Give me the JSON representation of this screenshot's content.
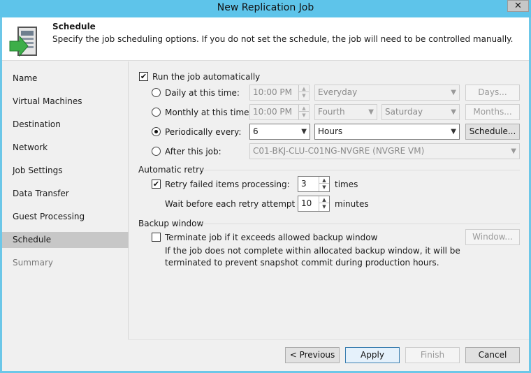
{
  "window": {
    "title": "New Replication Job",
    "close_glyph": "✕"
  },
  "header": {
    "title": "Schedule",
    "description": "Specify the job scheduling options. If you do not set the schedule, the job will need to be controlled manually.",
    "icon": "schedule-wizard-icon"
  },
  "sidebar": {
    "items": [
      {
        "label": "Name",
        "state": "normal"
      },
      {
        "label": "Virtual Machines",
        "state": "normal"
      },
      {
        "label": "Destination",
        "state": "normal"
      },
      {
        "label": "Network",
        "state": "normal"
      },
      {
        "label": "Job Settings",
        "state": "normal"
      },
      {
        "label": "Data Transfer",
        "state": "normal"
      },
      {
        "label": "Guest Processing",
        "state": "normal"
      },
      {
        "label": "Schedule",
        "state": "active"
      },
      {
        "label": "Summary",
        "state": "disabled"
      }
    ]
  },
  "schedule": {
    "run_auto": {
      "label": "Run the job automatically",
      "checked": true
    },
    "daily": {
      "label": "Daily at this time:",
      "time": "10:00 PM",
      "days": "Everyday",
      "button": "Days...",
      "selected": false
    },
    "monthly": {
      "label": "Monthly at this time:",
      "time": "10:00 PM",
      "week": "Fourth",
      "weekday": "Saturday",
      "button": "Months...",
      "selected": false
    },
    "periodic": {
      "label": "Periodically every:",
      "value": "6",
      "unit": "Hours",
      "button": "Schedule...",
      "selected": true
    },
    "after": {
      "label": "After this job:",
      "job": "C01-BKJ-CLU-C01NG-NVGRE (NVGRE VM)",
      "selected": false
    }
  },
  "retry": {
    "group_title": "Automatic retry",
    "retry_failed": {
      "label": "Retry failed items processing:",
      "checked": true,
      "value": "3",
      "unit": "times"
    },
    "wait": {
      "label": "Wait before each retry attempt for:",
      "value": "10",
      "unit": "minutes"
    }
  },
  "backup_window": {
    "group_title": "Backup window",
    "terminate": {
      "label": "Terminate job if it exceeds allowed backup window",
      "checked": false
    },
    "button": "Window...",
    "note_line1": "If the job does not complete within allocated backup window, it will be",
    "note_line2": "terminated to prevent snapshot commit during production hours."
  },
  "footer": {
    "previous": "< Previous",
    "apply": "Apply",
    "finish": "Finish",
    "cancel": "Cancel"
  },
  "glyphs": {
    "check": "✔",
    "dropdown": "▼",
    "spin_up": "▲",
    "spin_down": "▼"
  },
  "colors": {
    "titlebar": "#5ec4ea",
    "active_nav": "#c7c7c7",
    "window_bg": "#f0f0f0"
  }
}
